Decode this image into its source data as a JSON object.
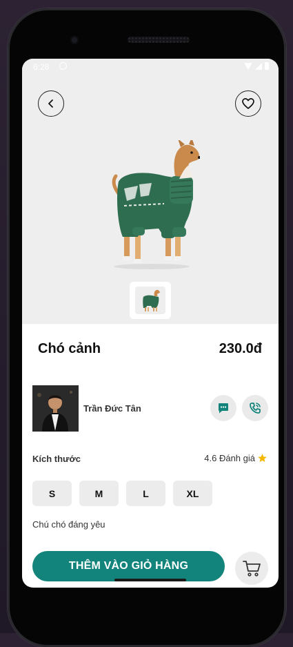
{
  "status_bar": {
    "time": "6:28"
  },
  "product": {
    "name": "Chó cảnh",
    "price": "230.0đ",
    "description": "Chú chó đáng yêu"
  },
  "seller": {
    "name": "Trần Đức Tân"
  },
  "size_section": {
    "label": "Kích thước",
    "rating_text": "4.6 Đánh giá",
    "options": [
      "S",
      "M",
      "L",
      "XL"
    ]
  },
  "actions": {
    "add_to_cart_label": "THÊM VÀO GIỎ HÀNG"
  },
  "colors": {
    "accent": "#12847b",
    "star": "#f5b800",
    "hero_bg": "#eeeeee"
  },
  "icons": {
    "back": "chevron-left-icon",
    "favorite": "heart-icon",
    "chat": "chat-bubble-icon",
    "call": "phone-icon",
    "cart": "cart-icon",
    "rating": "star-icon"
  }
}
